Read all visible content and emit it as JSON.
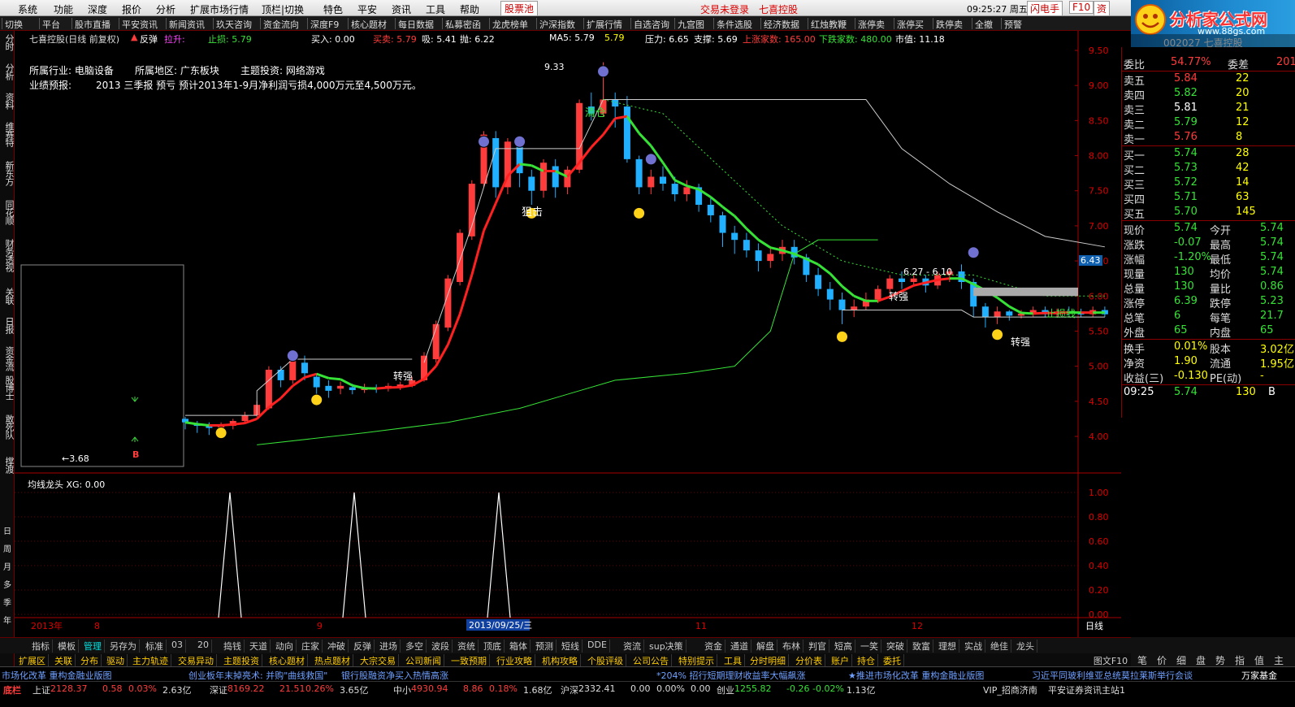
{
  "menu": {
    "items": [
      "系统",
      "功能",
      "深度",
      "报价",
      "分析",
      "扩展市场行情",
      "顶栏|切换",
      "特色",
      "平安",
      "资讯",
      "工具",
      "帮助"
    ],
    "stock_pool": "股票池",
    "login_status": "交易未登录",
    "stock_name": "七喜控股",
    "clock": "09:25:27 周五",
    "quick_btns": [
      "闪电手",
      "F10",
      "资"
    ]
  },
  "toolbar": {
    "items": [
      "切换",
      "平台",
      "股市直播",
      "平安资讯",
      "新闻资讯",
      "玖天咨询",
      "资金流向",
      "深度F9",
      "核心题材",
      "每日数据",
      "私募密函",
      "龙虎榜单",
      "沪深指数",
      "扩展行情",
      "自选咨询",
      "九宫图",
      "条件选股",
      "经济数据",
      "红烛教鞭",
      "涨停卖",
      "涨停买",
      "跌停卖",
      "全撤",
      "预警"
    ]
  },
  "logo": {
    "title": "分析家公式网",
    "url": "www.88gs.com",
    "code_peek": "002027 七喜控股"
  },
  "leftnav": {
    "items": [
      "分时",
      "分析",
      "资料",
      "维赛特",
      "新东方",
      "同花顺",
      "财务透视",
      "关联",
      "日报",
      "资金流",
      "股博士",
      "敢死队",
      "撑渡"
    ],
    "lower": [
      "日",
      "周",
      "月",
      "多",
      "季",
      "年"
    ]
  },
  "chart_header": {
    "name": "七喜控股(日线 前复权)",
    "rebound": "反弹",
    "pull": "拉升:",
    "stop": "止损: 5.79",
    "buy": "买入: 0.00",
    "sell": "买卖: 5.79",
    "absorb": "吸: 5.41",
    "throw": "抛: 6.22",
    "ma5": "MA5: 5.79",
    "ma5b": "5.79",
    "pressure": "压力: 6.65",
    "support": "支撑: 5.69",
    "up_count": "上涨家数: 165.00",
    "down_count": "下跌家数: 480.00",
    "mktval": "市值: 11.18"
  },
  "company": {
    "industry": "所属行业: 电脑设备",
    "region": "所属地区: 广东板块",
    "theme": "主题投资: 网络游戏",
    "forecast_label": "业绩预报:",
    "forecast": "2013 三季报 预亏 预计2013年1-9月净利润亏损4,000万元至4,500万元。"
  },
  "annotations": {
    "high": "9.33",
    "clear": "清仓",
    "block": "狙击",
    "strong1": "转强",
    "strong2": "转强",
    "strong3": "转强",
    "range": "6.27 - 6.10",
    "stopline": "止损线",
    "current_tag": "6.43",
    "low_arrow": "←3.68",
    "b_mark": "B"
  },
  "yaxis": [
    "9.50",
    "9.00",
    "8.50",
    "8.00",
    "7.50",
    "7.00",
    "6.50",
    "6.00",
    "5.50",
    "5.00",
    "4.50",
    "4.00"
  ],
  "sub_chart": {
    "title": "均线龙头 XG: 0.00",
    "yaxis": [
      "1.00",
      "0.80",
      "0.60",
      "0.40",
      "0.20",
      "0.00"
    ]
  },
  "xaxis": {
    "year": "2013年",
    "m8": "8",
    "m9": "9",
    "date": "2013/09/25/三",
    "m11": "11",
    "m12": "12",
    "period": "日线"
  },
  "quote": {
    "wei_bi": [
      "委比",
      "54.77%",
      "委差",
      "201"
    ],
    "sells": [
      [
        "卖五",
        "5.84",
        "22"
      ],
      [
        "卖四",
        "5.82",
        "20"
      ],
      [
        "卖三",
        "5.81",
        "21"
      ],
      [
        "卖二",
        "5.79",
        "12"
      ],
      [
        "卖一",
        "5.76",
        "8"
      ]
    ],
    "buys": [
      [
        "买一",
        "5.74",
        "28"
      ],
      [
        "买二",
        "5.73",
        "42"
      ],
      [
        "买三",
        "5.72",
        "14"
      ],
      [
        "买四",
        "5.71",
        "63"
      ],
      [
        "买五",
        "5.70",
        "145"
      ]
    ],
    "stats": [
      [
        "现价",
        "5.74",
        "今开",
        "5.74"
      ],
      [
        "涨跌",
        "-0.07",
        "最高",
        "5.74"
      ],
      [
        "涨幅",
        "-1.20%",
        "最低",
        "5.74"
      ],
      [
        "现量",
        "130",
        "均价",
        "5.74"
      ],
      [
        "总量",
        "130",
        "量比",
        "0.86"
      ],
      [
        "涨停",
        "6.39",
        "跌停",
        "5.23"
      ],
      [
        "总笔",
        "6",
        "每笔",
        "21.7"
      ],
      [
        "外盘",
        "65",
        "内盘",
        "65"
      ]
    ],
    "stats2": [
      [
        "换手",
        "0.01%",
        "股本",
        "3.02亿"
      ],
      [
        "净资",
        "1.90",
        "流通",
        "1.95亿"
      ],
      [
        "收益(三)",
        "-0.130",
        "PE(动)",
        "-"
      ]
    ],
    "tick": [
      "09:25",
      "5.74",
      "130",
      "B"
    ]
  },
  "bottom_tabs": [
    "指标",
    "模板",
    "管理",
    "另存为",
    "标准",
    "03",
    "20",
    "捣钱",
    "天道",
    "动向",
    "庄家",
    "冲破",
    "反弹",
    "进场",
    "多空",
    "波段",
    "资统",
    "顶底",
    "箱体",
    "预测",
    "短线",
    "DDE",
    "资流",
    "sup决策",
    "资金",
    "通道",
    "解盘",
    "布林",
    "判官",
    "短高",
    "一笑",
    "突破",
    "致富",
    "理想",
    "实战",
    "绝佳",
    "龙头"
  ],
  "bottom_tabs2": [
    "扩展区",
    "关联",
    "分布",
    "驱动",
    "主力轨迹",
    "交易异动",
    "主题投资",
    "核心题材",
    "热点题材",
    "大宗交易",
    "公司新闻",
    "一致预期",
    "行业攻略",
    "机构攻略",
    "个股评级",
    "公司公告",
    "特别提示",
    "工具",
    "分时明细",
    "分价表",
    "账户",
    "持仓",
    "委托"
  ],
  "right_bottom": [
    "图文F10",
    "笔",
    "价",
    "细",
    "盘",
    "势",
    "指",
    "值",
    "主"
  ],
  "ticker": [
    "市场化改革 重构金融业版图",
    "创业板年末掉亮术: 并购\"曲线救国\"",
    "银行股融资净买入热情高涨",
    "*204% 招行短期理财收益率大幅飙涨",
    "★推进市场化改革 重构金融业版图",
    "习近平同玻利维亚总统莫拉莱斯举行会谈",
    "万家基金"
  ],
  "status": {
    "label": "底栏",
    "sh": [
      "上证",
      "2128.37",
      "0.58",
      "0.03%",
      "2.63亿"
    ],
    "sz": [
      "深证",
      "8169.22",
      "21.51",
      "0.26%",
      "3.65亿"
    ],
    "zx": [
      "中小",
      "4930.94",
      "8.86",
      "0.18%",
      "1.68亿"
    ],
    "hs": [
      "沪深",
      "2332.41",
      "0.00",
      "0.00%",
      "0.00"
    ],
    "cy": [
      "创业",
      "1255.82",
      "-0.26",
      "-0.02%",
      "1.13亿"
    ],
    "vip": "VIP_招商济南",
    "site": "平安证券资讯主站1"
  },
  "colors": {
    "up": "#ff3c3c",
    "down": "#00d8d8",
    "ma": "#37e237",
    "accent": "#ffff00"
  }
}
